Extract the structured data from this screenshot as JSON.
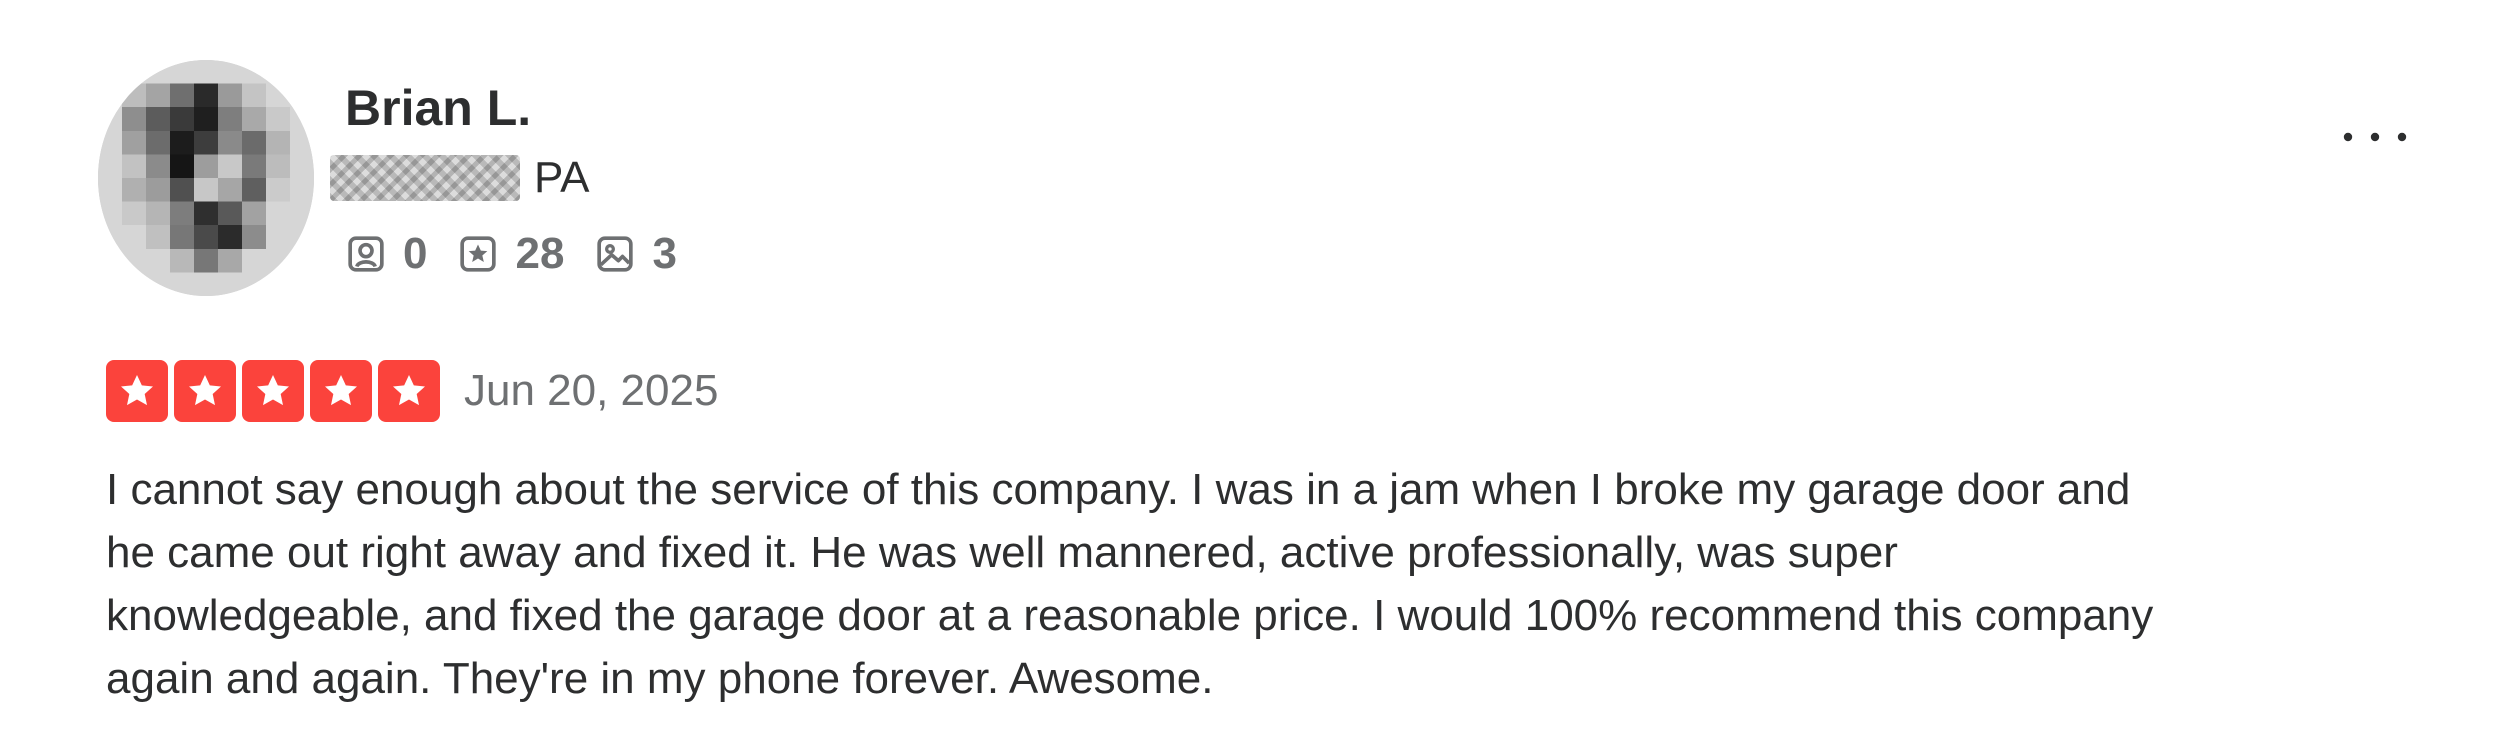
{
  "review": {
    "user": {
      "name": "Brian L.",
      "location_state": "PA",
      "stats": {
        "friends": "0",
        "reviews": "28",
        "photos": "3"
      },
      "icons": {
        "friends": "friends-icon",
        "reviews": "review-star-icon",
        "photos": "photo-icon"
      }
    },
    "rating": {
      "stars": 5,
      "max": 5,
      "color": "#fb433c"
    },
    "date": "Jun 20, 2025",
    "text": "I cannot say enough about the service of this company. I was in a jam when I broke my garage door and he came out right away and fixed it. He was well mannered, active professionally, was super knowledgeable, and fixed the garage door at a reasonable price. I would 100% recommend this company again and again. They're in my phone forever. Awesome."
  }
}
